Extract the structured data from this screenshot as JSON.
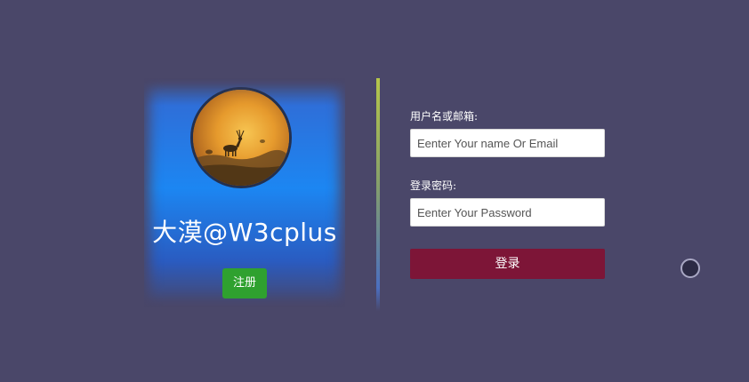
{
  "profile": {
    "avatar_icon": "deer-sunset-avatar",
    "brand_name": "大漠@W3cplus",
    "register_label": "注册"
  },
  "login_form": {
    "username_label": "用户名或邮箱:",
    "username_placeholder": "Eenter Your name Or Email",
    "password_label": "登录密码:",
    "password_placeholder": "Eenter Your Password",
    "submit_label": "登录"
  },
  "colors": {
    "background": "#4a4769",
    "card_blue": "#1c86f2",
    "register_green": "#2fa12f",
    "login_maroon": "#7d1537"
  }
}
